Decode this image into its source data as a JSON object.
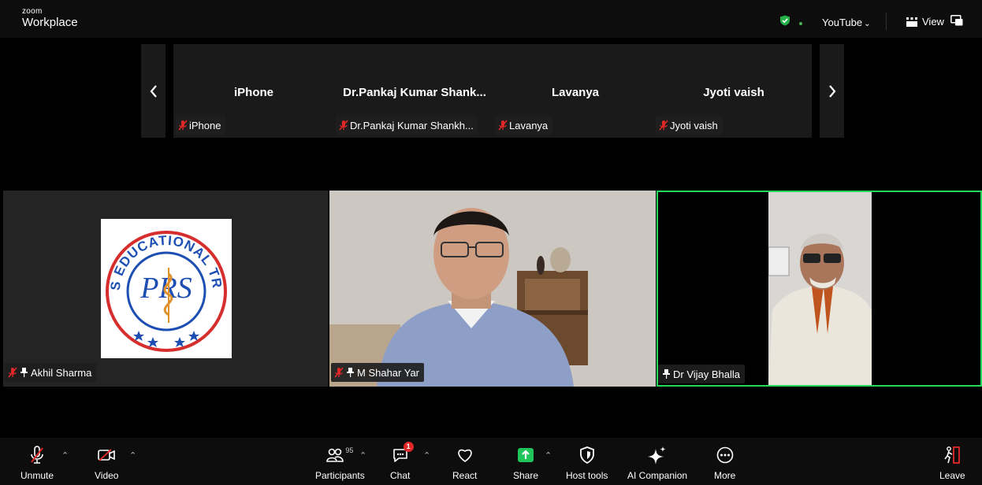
{
  "app": {
    "brand_small": "zoom",
    "brand_big": "Workplace"
  },
  "header": {
    "share_source": "YouTube",
    "view_label": "View"
  },
  "gallery": {
    "tiles": [
      {
        "display_name": "iPhone",
        "tag": "iPhone"
      },
      {
        "display_name": "Dr.Pankaj Kumar Shank...",
        "tag": "Dr.Pankaj Kumar Shankh..."
      },
      {
        "display_name": "Lavanya",
        "tag": "Lavanya"
      },
      {
        "display_name": "Jyoti vaish",
        "tag": "Jyoti vaish"
      }
    ]
  },
  "main": {
    "tiles": [
      {
        "name": "Akhil Sharma",
        "muted": true,
        "pinned": true
      },
      {
        "name": "M Shahar Yar",
        "muted": true,
        "pinned": true
      },
      {
        "name": "Dr Vijay Bhalla",
        "muted": false,
        "pinned": true,
        "active_speaker": true
      }
    ],
    "logo_text": {
      "arc_top": "P.R.S EDUCATIONAL TRUST",
      "monogram": "PRS"
    }
  },
  "toolbar": {
    "unmute": "Unmute",
    "video": "Video",
    "participants": "Participants",
    "participant_count": "95",
    "chat": "Chat",
    "chat_badge": "1",
    "react": "React",
    "share": "Share",
    "host_tools": "Host tools",
    "ai_companion": "AI Companion",
    "more": "More",
    "leave": "Leave"
  },
  "colors": {
    "active_speaker_border": "#23d959",
    "share_green": "#1fc45b",
    "mute_red": "#e02828",
    "badge_red": "#e02828"
  }
}
